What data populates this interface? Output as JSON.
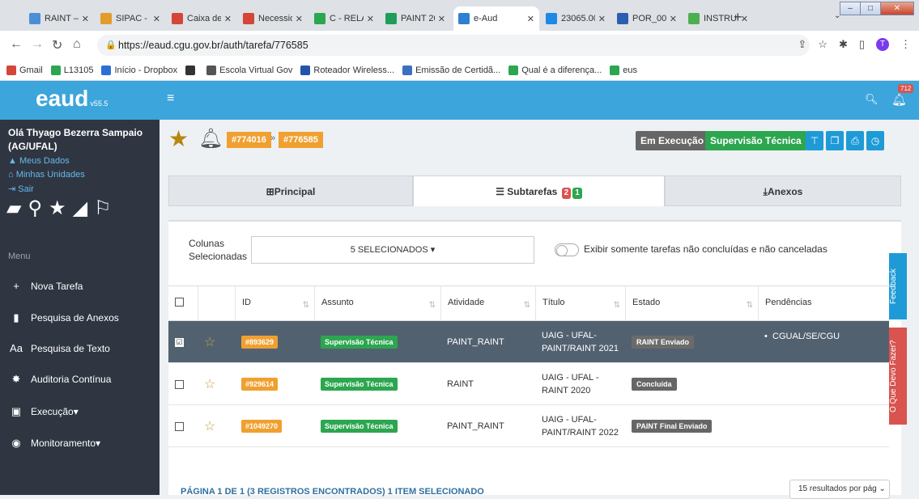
{
  "browser": {
    "tabs": [
      {
        "label": "RAINT —",
        "color": "#4a8fd6"
      },
      {
        "label": "SIPAC - S",
        "color": "#e39b2a"
      },
      {
        "label": "Caixa de",
        "color": "#d44638"
      },
      {
        "label": "Necessid",
        "color": "#d44638"
      },
      {
        "label": "C - RELAT",
        "color": "#2ca64f"
      },
      {
        "label": "PAINT 20",
        "color": "#1e9e5a"
      },
      {
        "label": "e-Aud",
        "color": "#2f80d1"
      },
      {
        "label": "23065.00",
        "color": "#1e88e5"
      },
      {
        "label": "POR_001",
        "color": "#2b5eb0"
      },
      {
        "label": "INSTRUÇ",
        "color": "#4caf50"
      }
    ],
    "url": "https://eaud.cgu.gov.br/auth/tarefa/776585",
    "profile_initial": "T",
    "bookmarks": [
      {
        "label": "Gmail",
        "color": "#d44638"
      },
      {
        "label": "L13105",
        "color": "#2ca64f"
      },
      {
        "label": "Início - Dropbox",
        "color": "#2b6fd6"
      },
      {
        "label": "",
        "color": "#333"
      },
      {
        "label": "Escola Virtual Gov",
        "color": "#555"
      },
      {
        "label": "Roteador Wireless...",
        "color": "#2255aa"
      },
      {
        "label": "Emissão de Certidã...",
        "color": "#3b6fbf"
      },
      {
        "label": "Qual é a diferença...",
        "color": "#2ca64f"
      },
      {
        "label": "eus",
        "color": "#2ca64f"
      }
    ]
  },
  "app": {
    "logo": "eaud",
    "version": "v55.5",
    "notif_count": "712"
  },
  "sidebar": {
    "greeting": "Olá Thyago Bezerra Sampaio (AG/UFAL)",
    "links": [
      "Meus Dados",
      "Minhas Unidades",
      "Sair"
    ],
    "menu_label": "Menu",
    "menu": [
      {
        "label": "Nova Tarefa",
        "icon": "plus-icon",
        "glyph": "+"
      },
      {
        "label": "Pesquisa de Anexos",
        "icon": "file-icon",
        "glyph": "▮"
      },
      {
        "label": "Pesquisa de Texto",
        "icon": "text-search-icon",
        "glyph": "Aa"
      },
      {
        "label": "Auditoria Contínua",
        "icon": "paw-icon",
        "glyph": "✸"
      },
      {
        "label": "Execução",
        "icon": "clipboard-icon",
        "glyph": "▣"
      },
      {
        "label": "Monitoramento",
        "icon": "eye-icon",
        "glyph": "◉"
      }
    ]
  },
  "header": {
    "parent_id": "#774016",
    "task_id": "#776585",
    "status": "Em Execução",
    "type": "Supervisão Técnica"
  },
  "tabs": {
    "principal": "Principal",
    "subtarefas": "Subtarefas",
    "subtarefas_red": "2",
    "subtarefas_green": "1",
    "anexos": "Anexos"
  },
  "filters": {
    "cols_label": "Colunas Selecionadas",
    "cols_value": "5 SELECIONADOS",
    "toggle_label": "Exibir somente tarefas não concluídas e não canceladas"
  },
  "table": {
    "headers": [
      "ID",
      "Assunto",
      "Atividade",
      "Título",
      "Estado",
      "Pendências"
    ],
    "rows": [
      {
        "id": "#893629",
        "assunto": "Supervisão Técnica",
        "atividade": "PAINT_RAINT",
        "titulo": "UAIG - UFAL-PAINT/RAINT 2021",
        "estado": "RAINT Enviado",
        "pendencia": "CGUAL/SE/CGU",
        "checked": "☑"
      },
      {
        "id": "#929614",
        "assunto": "Supervisão Técnica",
        "atividade": "RAINT",
        "titulo": "UAIG - UFAL - RAINT 2020",
        "estado": "Concluída",
        "pendencia": "",
        "checked": ""
      },
      {
        "id": "#1049270",
        "assunto": "Supervisão Técnica",
        "atividade": "PAINT_RAINT",
        "titulo": "UAIG - UFAL-PAINT/RAINT 2022",
        "estado": "PAINT Final Enviado",
        "pendencia": "",
        "checked": ""
      }
    ]
  },
  "footer": {
    "info": "PÁGINA 1 DE 1 (3 REGISTROS ENCONTRADOS)   1 ITEM SELECIONADO",
    "per_page": "15 resultados por pág"
  },
  "side_tabs": {
    "feedback": "Feedback",
    "help": "O Que Devo Fazer?"
  }
}
